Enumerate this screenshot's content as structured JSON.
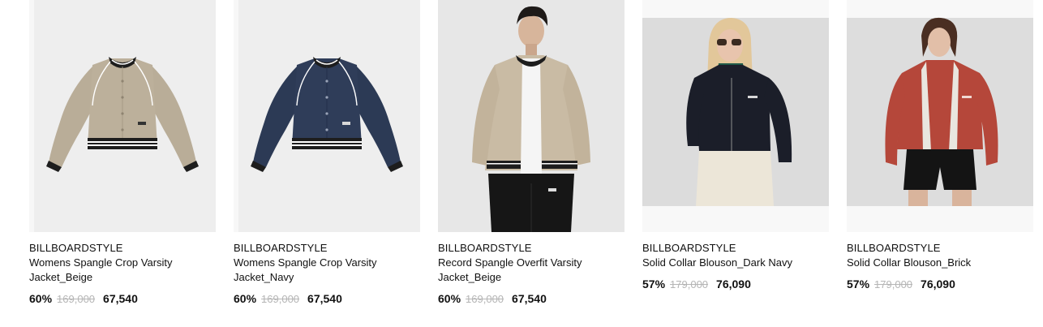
{
  "products": [
    {
      "brand": "BILLBOARDSTYLE",
      "name": "Womens Spangle Crop Varsity Jacket_Beige",
      "discount": "60%",
      "original_price": "169,000",
      "sale_price": "67,540",
      "image_icon": "beige-varsity-jacket-image"
    },
    {
      "brand": "BILLBOARDSTYLE",
      "name": "Womens Spangle Crop Varsity Jacket_Navy",
      "discount": "60%",
      "original_price": "169,000",
      "sale_price": "67,540",
      "image_icon": "navy-varsity-jacket-image"
    },
    {
      "brand": "BILLBOARDSTYLE",
      "name": "Record Spangle Overfit Varsity Jacket_Beige",
      "discount": "60%",
      "original_price": "169,000",
      "sale_price": "67,540",
      "image_icon": "model-beige-varsity-jacket-image"
    },
    {
      "brand": "BILLBOARDSTYLE",
      "name": "Solid Collar Blouson_Dark Navy",
      "discount": "57%",
      "original_price": "179,000",
      "sale_price": "76,090",
      "image_icon": "model-dark-navy-blouson-image"
    },
    {
      "brand": "BILLBOARDSTYLE",
      "name": "Solid Collar Blouson_Brick",
      "discount": "57%",
      "original_price": "179,000",
      "sale_price": "76,090",
      "image_icon": "model-brick-blouson-image"
    }
  ],
  "colors": {
    "beige": "#b9ad98",
    "navy": "#2c3a55",
    "brick": "#b5473a",
    "dark_navy": "#1b1e29",
    "strike": "#b5b5b5"
  }
}
